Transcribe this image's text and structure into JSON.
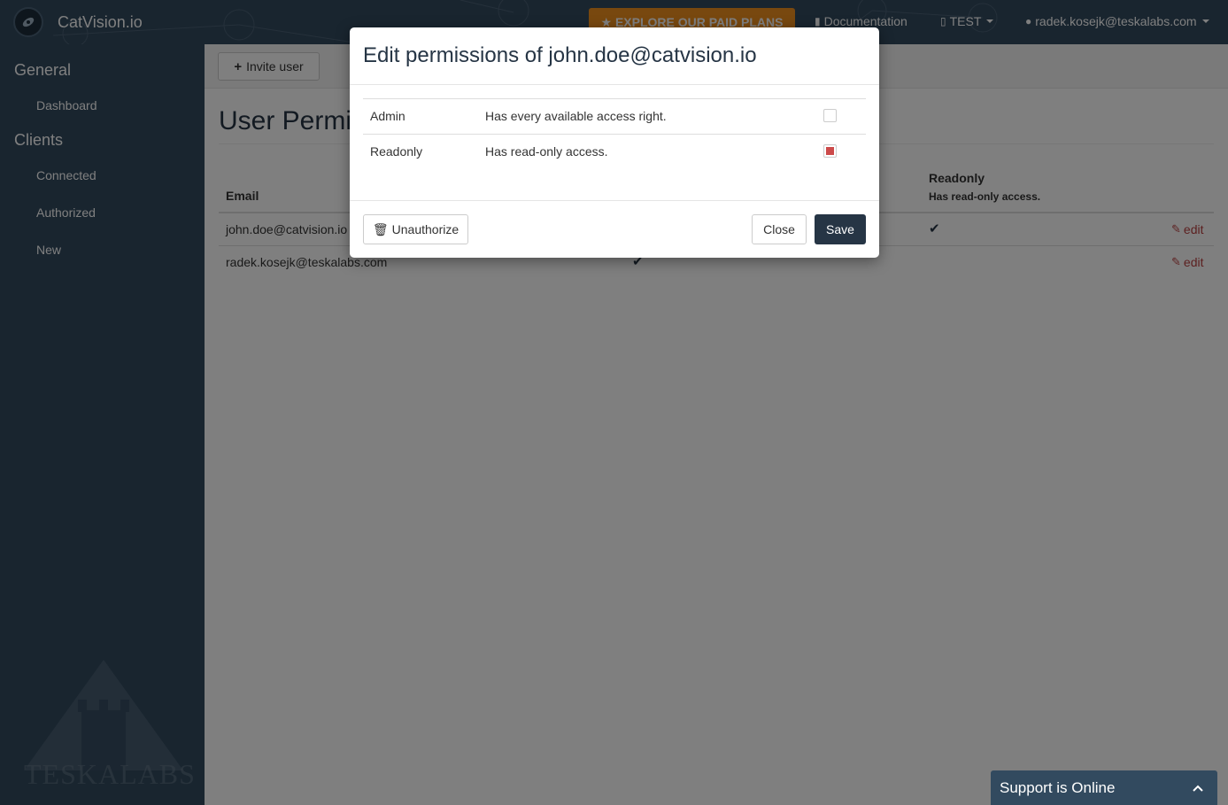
{
  "navbar": {
    "brand_name": "CatVision.io",
    "plans_label": "★ EXPLORE OUR PAID PLANS",
    "documentation_label": "Documentation",
    "project_label": "TEST",
    "user_label": "radek.kosejk@teskalabs.com"
  },
  "sidebar": {
    "sections": [
      {
        "heading": "General",
        "items": [
          {
            "label": "Dashboard"
          }
        ]
      },
      {
        "heading": "Clients",
        "items": [
          {
            "label": "Connected"
          },
          {
            "label": "Authorized"
          },
          {
            "label": "New"
          }
        ]
      }
    ],
    "watermark_text": "TESKALABS"
  },
  "main": {
    "invite_label": "Invite user",
    "page_title": "User Permi",
    "table": {
      "email_header": "Email",
      "readonly_header": "Readonly",
      "readonly_subheader": "Has read-only access.",
      "rows": [
        {
          "email": "john.doe@catvision.io",
          "edit_label": "edit"
        },
        {
          "email": "radek.kosejk@teskalabs.com",
          "edit_label": "edit"
        }
      ]
    }
  },
  "modal": {
    "title": "Edit permissions of john.doe@catvision.io",
    "permissions": [
      {
        "name": "Admin",
        "description": "Has every available access right.",
        "checked": false
      },
      {
        "name": "Readonly",
        "description": "Has read-only access.",
        "checked": true
      }
    ],
    "unauthorize_label": "Unauthorize",
    "close_label": "Close",
    "save_label": "Save"
  },
  "support": {
    "label": "Support is Online"
  },
  "colors": {
    "navbar": "#324a5f",
    "accent_orange": "#f0901e",
    "save_button": "#263545",
    "edit_link": "#b94040"
  }
}
